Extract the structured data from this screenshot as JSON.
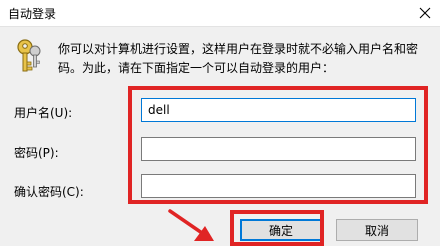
{
  "window": {
    "title": "自动登录",
    "close_icon": "close-icon"
  },
  "dialog": {
    "description": "你可以对计算机进行设置，这样用户在登录时就不必输入用户名和密码。为此，请在下面指定一个可以自动登录的用户：",
    "icon": "key-icon"
  },
  "form": {
    "username_label": "用户名(U):",
    "username_value": "dell",
    "password_label": "密码(P):",
    "password_value": "",
    "confirm_label": "确认密码(C):",
    "confirm_value": ""
  },
  "buttons": {
    "ok_label": "确定",
    "cancel_label": "取消"
  },
  "annotation": {
    "highlight_color": "#e02424"
  }
}
